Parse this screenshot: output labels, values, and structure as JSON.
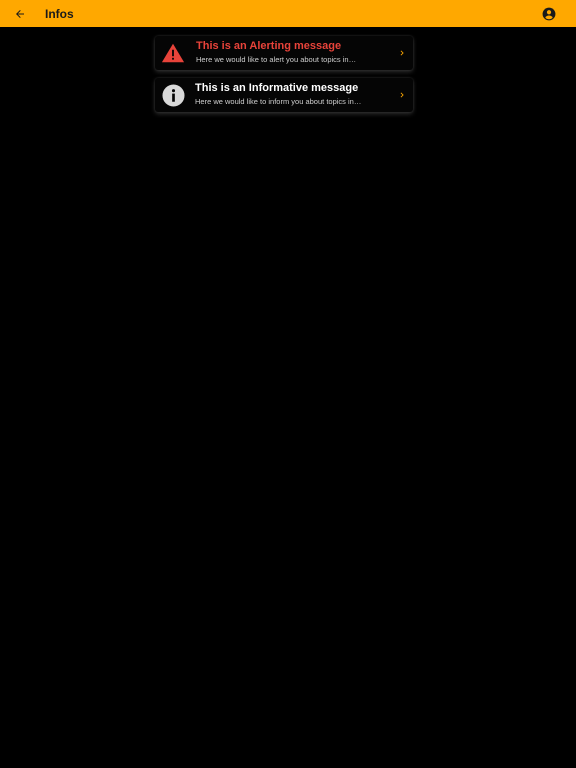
{
  "app_bar": {
    "title": "Infos",
    "back_icon": "arrow-left-icon",
    "account_icon": "account-circle-icon",
    "background": "#FFA800"
  },
  "messages": [
    {
      "type": "alert",
      "icon": "warning-triangle-icon",
      "title": "This is an Alerting message",
      "subtitle": "Here we would like to alert you about topics in…",
      "title_color": "#E8433A"
    },
    {
      "type": "info",
      "icon": "info-circle-icon",
      "title": "This is an Informative message",
      "subtitle": "Here we would like to inform you about topics in…",
      "title_color": "#FFFFFF"
    }
  ],
  "colors": {
    "accent": "#FFA800",
    "alert": "#E8433A",
    "background": "#000000"
  }
}
